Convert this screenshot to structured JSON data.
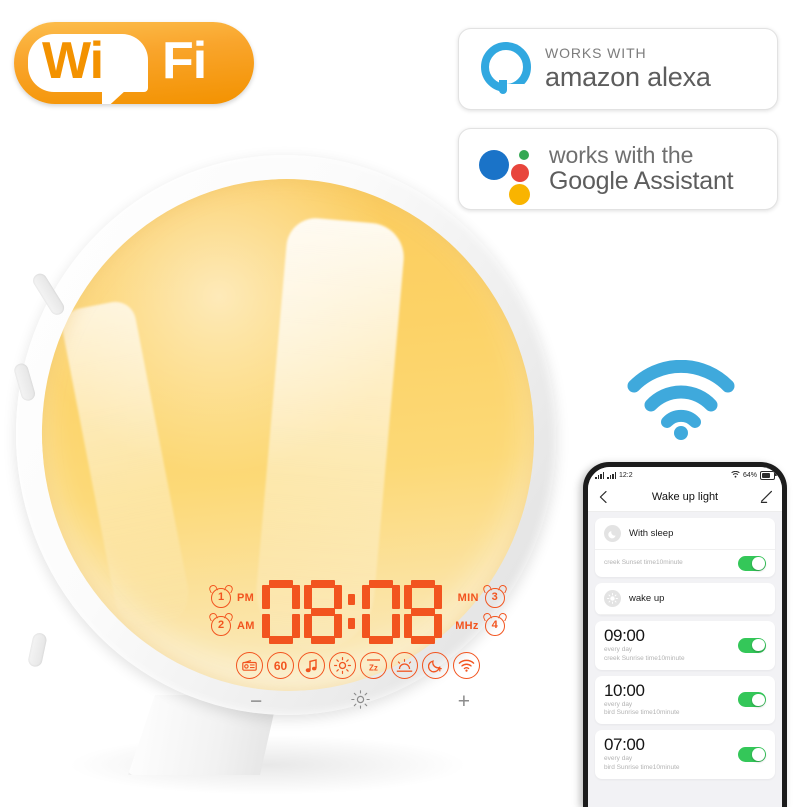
{
  "wifi_badge": {
    "wi": "Wi",
    "fi": "Fi"
  },
  "badges": {
    "alexa": {
      "icon": "alexa-ring-icon",
      "line1": "WORKS WITH",
      "line2": "amazon alexa"
    },
    "google": {
      "icon": "google-assistant-dots-icon",
      "line1": "works with the",
      "line2": "Google Assistant"
    }
  },
  "blue_wifi_icon": {
    "name": "wifi-signal-icon",
    "color": "#3fa9dc"
  },
  "device": {
    "name": "wake-up-light",
    "dome_color": "#fcd266",
    "housing_color": "#ffffff",
    "led_color": "#f2541f",
    "display": {
      "time": "08:08",
      "digits": [
        "0",
        "8",
        "8"
      ],
      "colon": ":",
      "left_labels": [
        "PM",
        "AM"
      ],
      "left_alarms": [
        "1",
        "2"
      ],
      "right_labels": [
        "MIN",
        "MHz"
      ],
      "right_alarms": [
        "3",
        "4"
      ]
    },
    "status_icons": [
      {
        "name": "radio-icon",
        "label": "radio"
      },
      {
        "name": "sleep-timer-60-icon",
        "label": "60"
      },
      {
        "name": "music-note-icon",
        "label": "music"
      },
      {
        "name": "brightness-sun-icon",
        "label": "sun"
      },
      {
        "name": "snooze-zz-icon",
        "label": "Zz"
      },
      {
        "name": "sunrise-icon",
        "label": "sunrise"
      },
      {
        "name": "moon-night-icon",
        "label": "moon"
      },
      {
        "name": "wifi-status-icon",
        "label": "wifi"
      }
    ],
    "touch_controls": [
      {
        "name": "minus-button",
        "glyph": "−"
      },
      {
        "name": "brightness-button",
        "glyph": "sun"
      },
      {
        "name": "plus-button",
        "glyph": "+"
      }
    ]
  },
  "phone": {
    "status_bar": {
      "time": "12:2",
      "battery_percent": "64%"
    },
    "app_bar": {
      "back": "back-arrow-icon",
      "title": "Wake up light",
      "edit": "edit-pencil-icon"
    },
    "sections": [
      {
        "header": "With sleep",
        "header_icon": "moon-icon",
        "rows": [
          {
            "time": "",
            "note1": "creek Sunset time10minute",
            "note2": "",
            "toggle": "on"
          }
        ]
      },
      {
        "header": "wake up",
        "header_icon": "sunrise-icon",
        "rows": [
          {
            "time": "09:00",
            "note1": "every day",
            "note2": "creek Sunrise time10minute",
            "toggle": "on"
          },
          {
            "time": "10:00",
            "note1": "every day",
            "note2": "bird Sunrise time10minute",
            "toggle": "on"
          },
          {
            "time": "07:00",
            "note1": "every day",
            "note2": "bird Sunrise time10minute",
            "toggle": "on"
          }
        ]
      }
    ]
  }
}
